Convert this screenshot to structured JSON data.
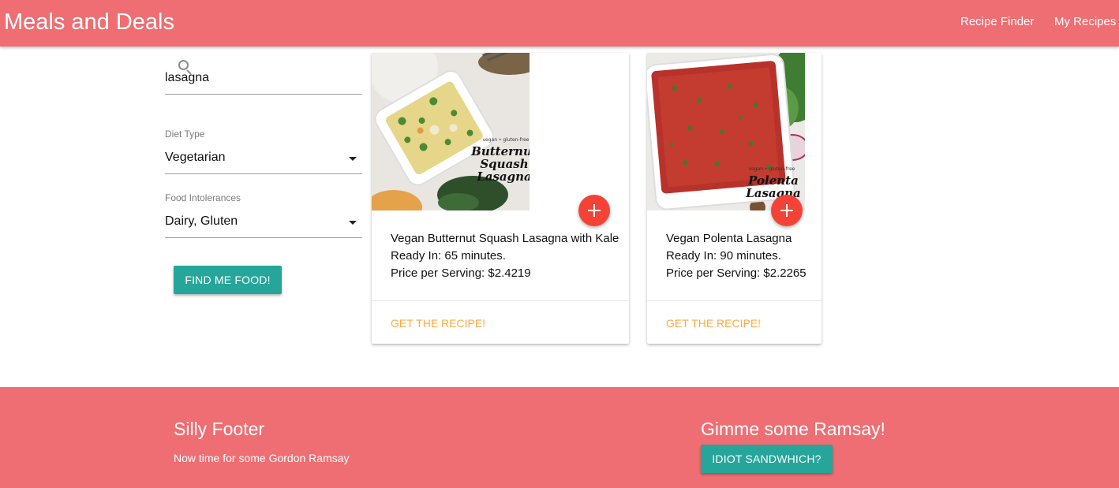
{
  "header": {
    "brand": "Meals and Deals",
    "nav": [
      "Recipe Finder",
      "My Recipes"
    ]
  },
  "search": {
    "query": "lasagna",
    "icon": "search-icon"
  },
  "filters": {
    "diet": {
      "label": "Diet Type",
      "value": "Vegetarian"
    },
    "intolerances": {
      "label": "Food Intolerances",
      "value": "Dairy, Gluten"
    },
    "submit_label": "FIND ME FOOD!"
  },
  "recipes": [
    {
      "title": "Vegan Butternut Squash Lasagna with Kale",
      "ready": "Ready In: 65 minutes.",
      "price": "Price per Serving: $2.4219",
      "image_caption": [
        "vegan • gluten-free",
        "Butternut",
        "Squash",
        "Lasagna"
      ],
      "action": "GET THE RECIPE!"
    },
    {
      "title": "Vegan Polenta Lasagna",
      "ready": "Ready In: 90 minutes.",
      "price": "Price per Serving: $2.2265",
      "image_caption": [
        "vegan • gluten-free",
        "Polenta",
        "Lasagna"
      ],
      "action": "GET THE RECIPE!"
    }
  ],
  "footer": {
    "title": "Silly Footer",
    "text": "Now time for some Gordon Ramsay",
    "ramsay_title": "Gimme some Ramsay!",
    "ramsay_button": "IDIOT SANDWHICH?"
  },
  "colors": {
    "brand": "#ee6e73",
    "button": "#26a69a",
    "fab": "#f44336",
    "link": "#ffab40"
  }
}
